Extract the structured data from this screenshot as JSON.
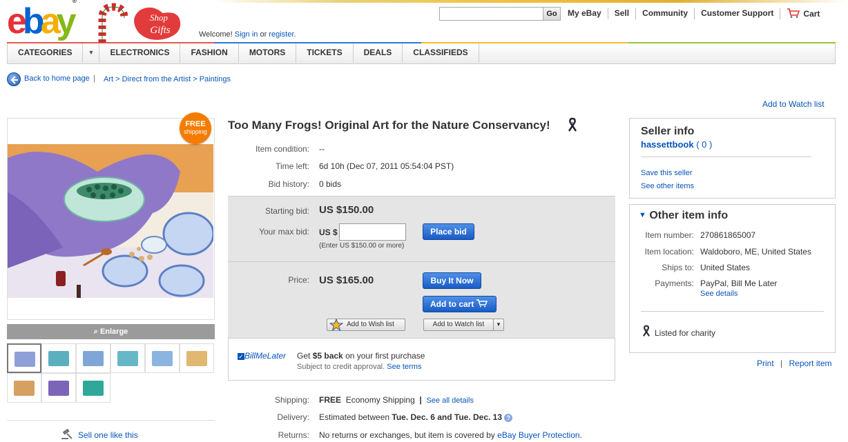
{
  "header": {
    "logo_text": [
      "e",
      "b",
      "a",
      "y"
    ],
    "logo_reg": "®",
    "doodle_text": "Shop Gifts",
    "welcome_prefix": "Welcome!",
    "sign_in": "Sign in",
    "or": "or",
    "register": "register.",
    "search_placeholder": "",
    "go_label": "Go",
    "nav": [
      "My eBay",
      "Sell",
      "Community",
      "Customer Support",
      "Cart"
    ]
  },
  "categories": [
    "CATEGORIES",
    "ELECTRONICS",
    "FASHION",
    "MOTORS",
    "TICKETS",
    "DEALS",
    "CLASSIFIEDS"
  ],
  "breadcrumb": {
    "back": "Back to home page",
    "sep": "|",
    "path": "Art > Direct from the Artist > Paintings"
  },
  "watch_link": "Add to Watch list",
  "image": {
    "badge_free": "FREE",
    "badge_shipping": "shipping",
    "enlarge": "Enlarge",
    "thumb_colors": [
      "#8fa0d8",
      "#5bb0c0",
      "#7fa6d6",
      "#66b8c8",
      "#8cb4e0",
      "#e0b870",
      "#d6a060",
      "#7c64b8",
      "#2fa89a"
    ]
  },
  "sell_one": "Sell one like this",
  "item": {
    "title": "Too Many Frogs! Original Art for the Nature Conservancy!",
    "condition_label": "Item condition:",
    "condition_value": "--",
    "time_left_label": "Time left:",
    "time_left_value": "6d 10h (Dec 07, 2011 05:54:04 PST)",
    "bid_history_label": "Bid history:",
    "bid_history_value": "0 bids",
    "starting_bid_label": "Starting bid:",
    "starting_bid_value": "US $150.00",
    "max_bid_label": "Your max bid:",
    "max_bid_currency": "US $",
    "max_bid_hint": "(Enter US $150.00 or more)",
    "place_bid": "Place bid",
    "price_label": "Price:",
    "price_value": "US $165.00",
    "buy_now": "Buy It Now",
    "add_to_cart": "Add to cart",
    "add_wish": "Add to Wish list",
    "add_watch": "Add to Watch list",
    "bml_logo": "BillMeLater",
    "bml_offer_pre": "Get",
    "bml_offer_bold": "$5 back",
    "bml_offer_post": "on your first purchase",
    "bml_sub": "Subject to credit approval.",
    "bml_terms": "See terms",
    "shipping_label": "Shipping:",
    "shipping_free": "FREE",
    "shipping_method": "Economy Shipping",
    "shipping_sep": "|",
    "shipping_details": "See all details",
    "delivery_label": "Delivery:",
    "delivery_pre": "Estimated between",
    "delivery_range": "Tue. Dec. 6 and Tue. Dec. 13",
    "returns_label": "Returns:",
    "returns_text": "No returns or exchanges, but item is covered by",
    "returns_link": "eBay Buyer Protection",
    "returns_end": "."
  },
  "seller": {
    "heading": "Seller info",
    "name": "hassettbook",
    "feedback": "( 0 )",
    "save": "Save this seller",
    "see_other": "See other items"
  },
  "other_info": {
    "heading": "Other item info",
    "item_number_label": "Item number:",
    "item_number": "270861865007",
    "location_label": "Item location:",
    "location": "Waldoboro, ME, United States",
    "ships_label": "Ships to:",
    "ships": "United States",
    "payments_label": "Payments:",
    "payments": "PayPal, Bill Me Later",
    "see_details": "See details",
    "charity": "Listed for charity"
  },
  "footer_links": {
    "print": "Print",
    "sep": "|",
    "report": "Report item"
  },
  "colors": {
    "link": "#0654ba",
    "button_blue": "#1a5bc4",
    "badge_orange": "#f57c00",
    "panel_grey": "#e5e5e5"
  }
}
